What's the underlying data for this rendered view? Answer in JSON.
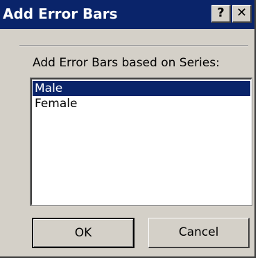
{
  "window": {
    "title": "Add Error Bars",
    "help_label": "?",
    "close_label": "✕"
  },
  "prompt": "Add Error Bars based on Series:",
  "series_list": {
    "items": [
      "Male",
      "Female"
    ],
    "selected": "Male"
  },
  "buttons": {
    "ok": "OK",
    "cancel": "Cancel"
  },
  "colors": {
    "titlebar": "#0a246a",
    "dialog_face": "#d4d0c8",
    "selection": "#0a246a"
  }
}
